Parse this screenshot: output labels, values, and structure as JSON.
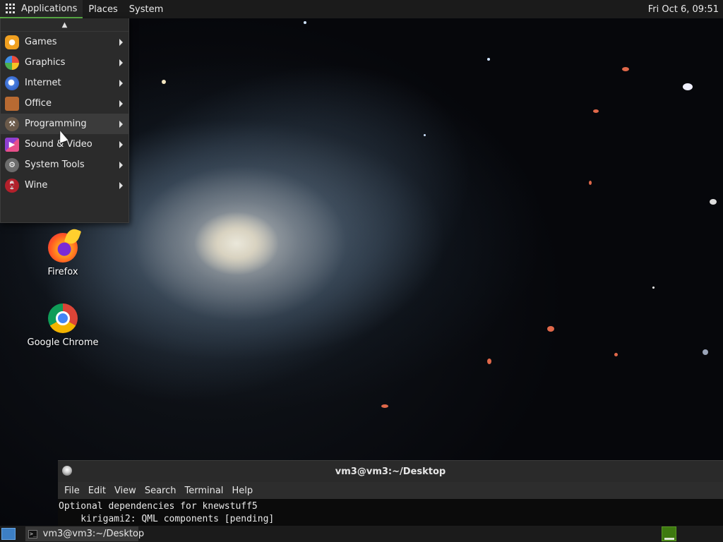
{
  "top_panel": {
    "applications_label": "Applications",
    "places_label": "Places",
    "system_label": "System",
    "clock": "Fri Oct  6, 09:51"
  },
  "app_menu": {
    "scroll_up_glyph": "▲",
    "items": [
      {
        "label": "Games",
        "icon": "games-icon"
      },
      {
        "label": "Graphics",
        "icon": "graphics-icon"
      },
      {
        "label": "Internet",
        "icon": "internet-icon"
      },
      {
        "label": "Office",
        "icon": "office-icon"
      },
      {
        "label": "Programming",
        "icon": "programming-icon",
        "hovered": true
      },
      {
        "label": "Sound & Video",
        "icon": "sound-video-icon"
      },
      {
        "label": "System Tools",
        "icon": "system-tools-icon"
      },
      {
        "label": "Wine",
        "icon": "wine-icon"
      }
    ]
  },
  "desktop_icons": [
    {
      "label": "Firefox",
      "icon": "firefox-icon"
    },
    {
      "label": "Google Chrome",
      "icon": "chrome-icon"
    }
  ],
  "terminal": {
    "title": "vm3@vm3:~/Desktop",
    "menu": [
      "File",
      "Edit",
      "View",
      "Search",
      "Terminal",
      "Help"
    ],
    "lines": [
      "Optional dependencies for knewstuff5",
      "    kirigami2: QML components [pending]"
    ]
  },
  "bottom_panel": {
    "task_label": "vm3@vm3:~/Desktop",
    "task_icon_text": ">_"
  },
  "colors": {
    "panel_bg": "#1b1b1b",
    "menu_bg": "#2b2b2b",
    "accent_green": "#5fb548",
    "workspace_green": "#3e7a10"
  }
}
